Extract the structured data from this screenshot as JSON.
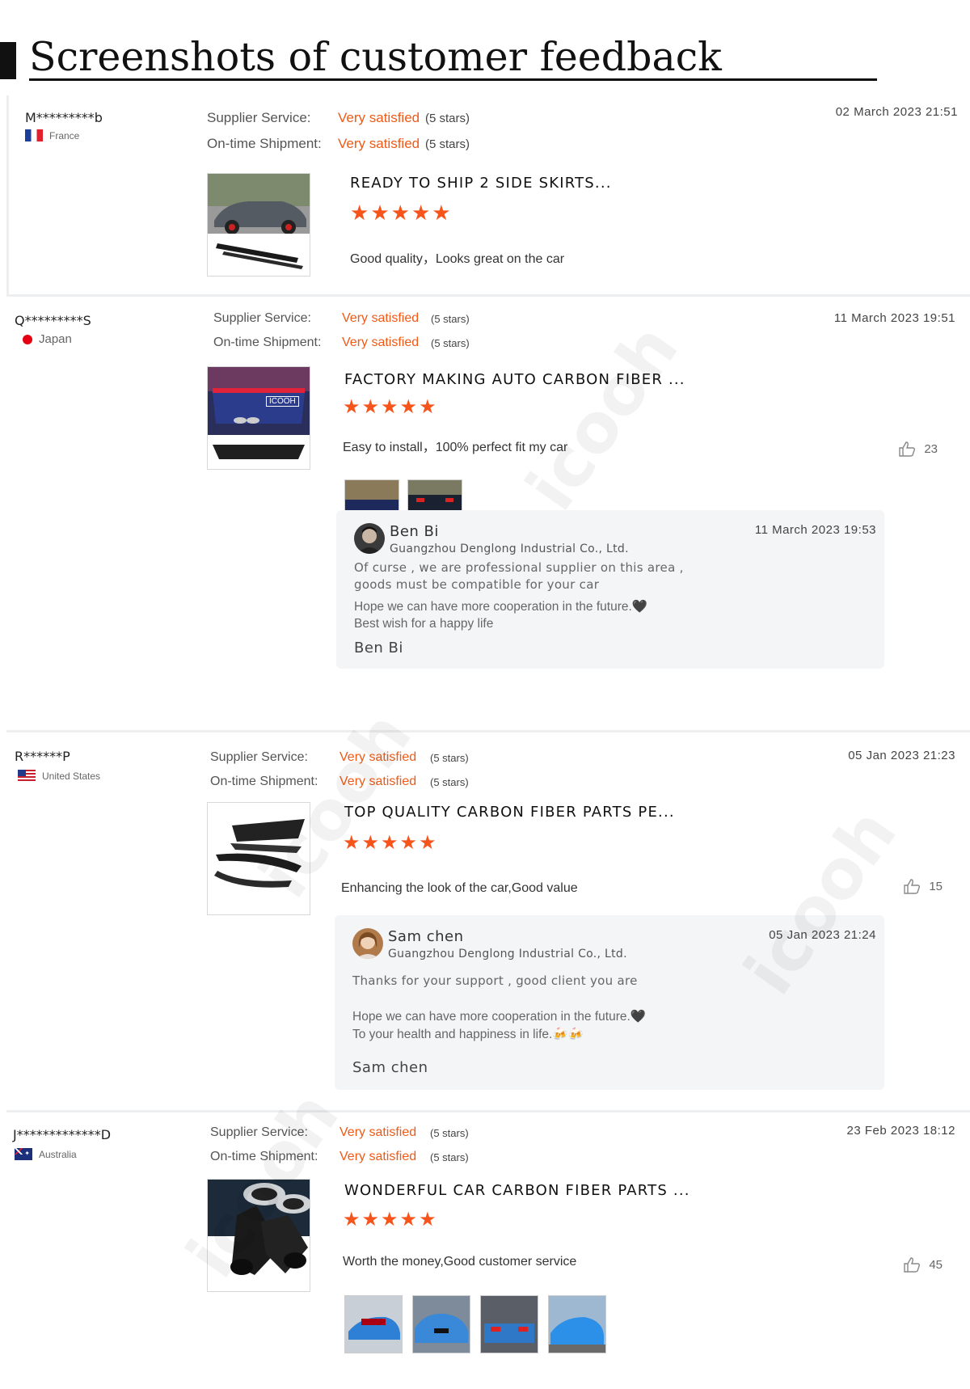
{
  "page_title": "Screenshots of customer feedback",
  "colors": {
    "accent": "#f05a16",
    "star": "#f7541c"
  },
  "reviews": [
    {
      "buyer": "M*********b",
      "country": "France",
      "ratings": [
        {
          "label": "Supplier Service:",
          "value": "Very satisfied",
          "stars": "(5 stars)"
        },
        {
          "label": "On-time Shipment:",
          "value": "Very satisfied",
          "stars": "(5 stars)"
        }
      ],
      "date": "02 March 2023 21:51",
      "product_title": "READY TO SHIP 2 SIDE SKIRTS...",
      "rating": 5,
      "comment": "Good quality，Looks great on the car"
    },
    {
      "buyer": "Q*********S",
      "country": "Japan",
      "ratings": [
        {
          "label": "Supplier Service:",
          "value": "Very satisfied",
          "stars": "(5 stars)"
        },
        {
          "label": "On-time Shipment:",
          "value": "Very satisfied",
          "stars": "(5 stars)"
        }
      ],
      "date": "11 March 2023 19:51",
      "product_title": "FACTORY MAKING AUTO CARBON FIBER ...",
      "thumb_label": "ICOOH",
      "rating": 5,
      "comment": "Easy to install，100% perfect fit my car",
      "likes": "23",
      "reply": {
        "name": "Ben Bi",
        "company": "Guangzhou Denglong Industrial Co., Ltd.",
        "date": "11 March 2023 19:53",
        "line1": "Of curse , we are professional supplier on this area ,",
        "line2": "goods must be compatible for  your car",
        "line3": "Hope we can have more cooperation in the future.🖤",
        "line4": "Best wish for a happy life",
        "signature": "Ben Bi"
      }
    },
    {
      "buyer": "R******P",
      "country": "United States",
      "ratings": [
        {
          "label": "Supplier Service:",
          "value": "Very satisfied",
          "stars": "(5 stars)"
        },
        {
          "label": "On-time Shipment:",
          "value": "Very satisfied",
          "stars": "(5 stars)"
        }
      ],
      "date": "05 Jan 2023 21:23",
      "product_title": "TOP QUALITY CARBON FIBER PARTS PE...",
      "rating": 5,
      "comment": "Enhancing the look of the car,Good value",
      "likes": "15",
      "reply": {
        "name": "Sam chen",
        "company": "Guangzhou Denglong Industrial Co., Ltd.",
        "date": "05 Jan 2023 21:24",
        "line1": "Thanks for your support , good client you are",
        "line3": "Hope we can have more cooperation in the future.🖤",
        "line4": "To your health and happiness in life.🍻🍻",
        "signature": "Sam chen"
      }
    },
    {
      "buyer": "J*************D",
      "country": "Australia",
      "ratings": [
        {
          "label": "Supplier Service:",
          "value": "Very satisfied",
          "stars": "(5 stars)"
        },
        {
          "label": "On-time Shipment:",
          "value": "Very satisfied",
          "stars": "(5 stars)"
        }
      ],
      "date": "23 Feb 2023 18:12",
      "product_title": "WONDERFUL CAR CARBON FIBER PARTS ...",
      "rating": 5,
      "comment": "Worth the money,Good customer service",
      "likes": "45"
    }
  ],
  "watermark": "icooh",
  "icons": {
    "star": "star-icon",
    "like": "thumbs-up-icon"
  }
}
